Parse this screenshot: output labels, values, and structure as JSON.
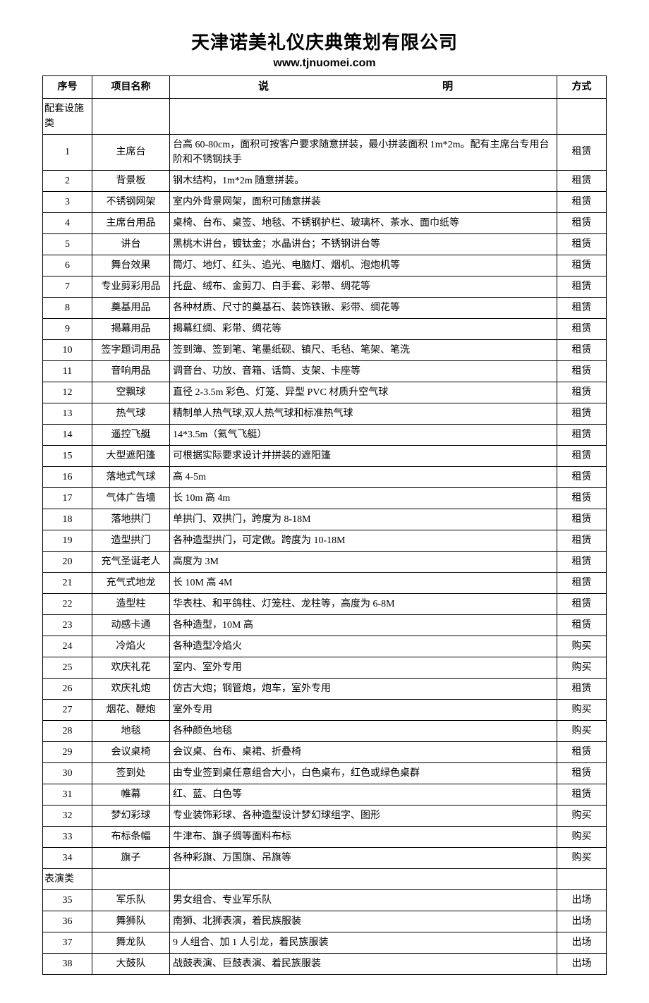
{
  "header": {
    "title": "天津诺美礼仪庆典策划有限公司",
    "url": "www.tjnuomei.com"
  },
  "columns": {
    "num": "序号",
    "name": "项目名称",
    "desc_left": "说",
    "desc_right": "明",
    "mode": "方式"
  },
  "sections": [
    {
      "title": "配套设施类",
      "rows": [
        {
          "num": "1",
          "name": "主席台",
          "desc": "台高 60-80cm，面积可按客户要求随意拼装，最小拼装面积 1m*2m。配有主席台专用台阶和不锈钢扶手",
          "mode": "租赁"
        },
        {
          "num": "2",
          "name": "背景板",
          "desc": "钢木结构，1m*2m 随意拼装。",
          "mode": "租赁"
        },
        {
          "num": "3",
          "name": "不锈钢网架",
          "desc": "室内外背景网架，面积可随意拼装",
          "mode": "租赁"
        },
        {
          "num": "4",
          "name": "主席台用品",
          "desc": "桌椅、台布、桌签、地毯、不锈钢护栏、玻璃杯、茶水、面巾纸等",
          "mode": "租赁"
        },
        {
          "num": "5",
          "name": "讲台",
          "desc": "黑桃木讲台，镀钛金；水晶讲台；不锈钢讲台等",
          "mode": "租赁"
        },
        {
          "num": "6",
          "name": "舞台效果",
          "desc": "筒灯、地灯、红头、追光、电脑灯、烟机、泡炮机等",
          "mode": "租赁"
        },
        {
          "num": "7",
          "name": "专业剪彩用品",
          "desc": "托盘、绒布、金剪刀、白手套、彩带、绸花等",
          "mode": "租赁"
        },
        {
          "num": "8",
          "name": "奠基用品",
          "desc": "各种材质、尺寸的奠基石、装饰铁锹、彩带、绸花等",
          "mode": "租赁"
        },
        {
          "num": "9",
          "name": "揭幕用品",
          "desc": "揭幕红绸、彩带、绸花等",
          "mode": "租赁"
        },
        {
          "num": "10",
          "name": "签字题词用品",
          "desc": "签到簿、签到笔、笔墨纸砚、镇尺、毛毡、笔架、笔洗",
          "mode": "租赁"
        },
        {
          "num": "11",
          "name": "音响用品",
          "desc": "调音台、功放、音箱、话筒、支架、卡座等",
          "mode": "租赁"
        },
        {
          "num": "12",
          "name": "空飘球",
          "desc": "直径 2-3.5m 彩色、灯笼、异型 PVC 材质升空气球",
          "mode": "租赁"
        },
        {
          "num": "13",
          "name": "热气球",
          "desc": "精制单人热气球,双人热气球和标准热气球",
          "mode": "租赁"
        },
        {
          "num": "14",
          "name": "遥控飞艇",
          "desc": "14*3.5m（氦气飞艇）",
          "mode": "租赁"
        },
        {
          "num": "15",
          "name": "大型遮阳篷",
          "desc": "可根据实际要求设计并拼装的遮阳篷",
          "mode": "租赁"
        },
        {
          "num": "16",
          "name": "落地式气球",
          "desc": "高 4-5m",
          "mode": "租赁"
        },
        {
          "num": "17",
          "name": "气体广告墙",
          "desc": "长 10m 高 4m",
          "mode": "租赁"
        },
        {
          "num": "18",
          "name": "落地拱门",
          "desc": "单拱门、双拱门，跨度为 8-18M",
          "mode": "租赁"
        },
        {
          "num": "19",
          "name": "造型拱门",
          "desc": "各种造型拱门，可定做。跨度为 10-18M",
          "mode": "租赁"
        },
        {
          "num": "20",
          "name": "充气圣诞老人",
          "desc": "高度为 3M",
          "mode": "租赁"
        },
        {
          "num": "21",
          "name": "充气式地龙",
          "desc": "长 10M 高 4M",
          "mode": "租赁"
        },
        {
          "num": "22",
          "name": "造型柱",
          "desc": "华表柱、和平鸽柱、灯笼柱、龙柱等，高度为 6-8M",
          "mode": "租赁"
        },
        {
          "num": "23",
          "name": "动感卡通",
          "desc": "各种造型，10M 高",
          "mode": "租赁"
        },
        {
          "num": "24",
          "name": "冷焰火",
          "desc": "各种造型冷焰火",
          "mode": "购买"
        },
        {
          "num": "25",
          "name": "欢庆礼花",
          "desc": "室内、室外专用",
          "mode": "购买"
        },
        {
          "num": "26",
          "name": "欢庆礼炮",
          "desc": "仿古大炮；钢管炮，炮车，室外专用",
          "mode": "租赁"
        },
        {
          "num": "27",
          "name": "烟花、鞭炮",
          "desc": "室外专用",
          "mode": "购买"
        },
        {
          "num": "28",
          "name": "地毯",
          "desc": "各种颜色地毯",
          "mode": "购买"
        },
        {
          "num": "29",
          "name": "会议桌椅",
          "desc": "会议桌、台布、桌裙、折叠椅",
          "mode": "租赁"
        },
        {
          "num": "30",
          "name": "签到处",
          "desc": "由专业签到桌任意组合大小，白色桌布，红色或绿色桌群",
          "mode": "租赁"
        },
        {
          "num": "31",
          "name": "帷幕",
          "desc": "红、蓝、白色等",
          "mode": "租赁"
        },
        {
          "num": "32",
          "name": "梦幻彩球",
          "desc": "专业装饰彩球、各种造型设计梦幻球组字、图形",
          "mode": "购买"
        },
        {
          "num": "33",
          "name": "布标条幅",
          "desc": "牛津布、旗子绸等面料布标",
          "mode": "购买"
        },
        {
          "num": "34",
          "name": "旗子",
          "desc": "各种彩旗、万国旗、吊旗等",
          "mode": "购买"
        }
      ]
    },
    {
      "title": "表演类",
      "rows": [
        {
          "num": "35",
          "name": "军乐队",
          "desc": "男女组合、专业军乐队",
          "mode": "出场"
        },
        {
          "num": "36",
          "name": "舞狮队",
          "desc": "南狮、北狮表演，着民族服装",
          "mode": "出场"
        },
        {
          "num": "37",
          "name": "舞龙队",
          "desc": "9 人组合、加 1 人引龙，着民族服装",
          "mode": "出场"
        },
        {
          "num": "38",
          "name": "大鼓队",
          "desc": "战鼓表演、巨鼓表演、着民族服装",
          "mode": "出场"
        }
      ]
    }
  ]
}
